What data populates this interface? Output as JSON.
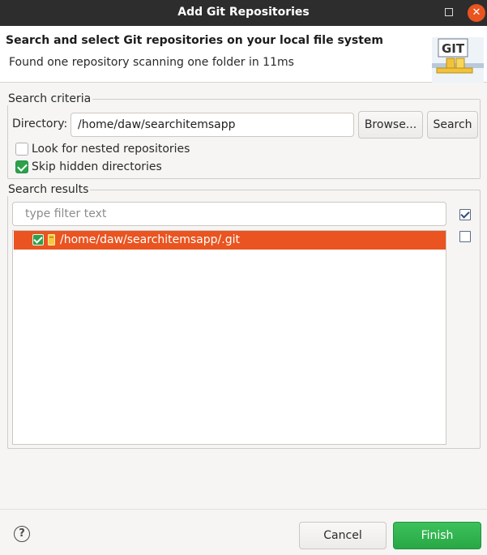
{
  "window": {
    "title": "Add Git Repositories",
    "close_glyph": "✕"
  },
  "header": {
    "heading": "Search and select Git repositories on your local file system",
    "message": "Found one repository scanning one folder in 11ms",
    "logo_text": "GIT"
  },
  "criteria": {
    "group_label": "Search criteria",
    "directory_label": "Directory:",
    "directory_value": "/home/daw/searchitemsapp",
    "browse_label": "Browse...",
    "search_label": "Search",
    "nested_label": "Look for nested repositories",
    "nested_checked": false,
    "skip_hidden_label": "Skip hidden directories",
    "skip_hidden_checked": true
  },
  "results": {
    "group_label": "Search results",
    "filter_placeholder": "type filter text",
    "items": [
      {
        "path": "/home/daw/searchitemsapp/.git",
        "checked": true,
        "selected": true
      }
    ]
  },
  "footer": {
    "help_glyph": "?",
    "cancel_label": "Cancel",
    "finish_label": "Finish"
  },
  "colors": {
    "selection": "#e95420",
    "checkbox_checked": "#2ca24a",
    "finish_button": "#2fb34e",
    "titlebar": "#2d2d2d"
  }
}
